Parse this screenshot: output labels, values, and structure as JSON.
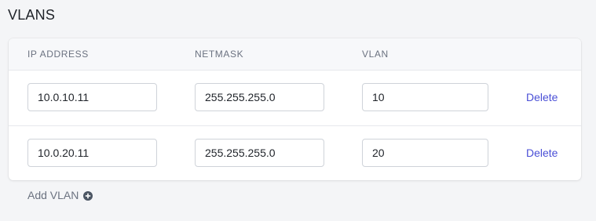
{
  "section": {
    "title": "VLANS"
  },
  "table": {
    "headers": {
      "ip": "IP ADDRESS",
      "netmask": "NETMASK",
      "vlan": "VLAN"
    },
    "rows": [
      {
        "ip": "10.0.10.11",
        "netmask": "255.255.255.0",
        "vlan": "10",
        "delete_label": "Delete"
      },
      {
        "ip": "10.0.20.11",
        "netmask": "255.255.255.0",
        "vlan": "20",
        "delete_label": "Delete"
      }
    ]
  },
  "actions": {
    "add_label": "Add VLAN",
    "add_icon": "plus-circle-icon"
  },
  "colors": {
    "accent": "#4a4fd6",
    "muted": "#6b7280",
    "background": "#f4f5f7"
  }
}
